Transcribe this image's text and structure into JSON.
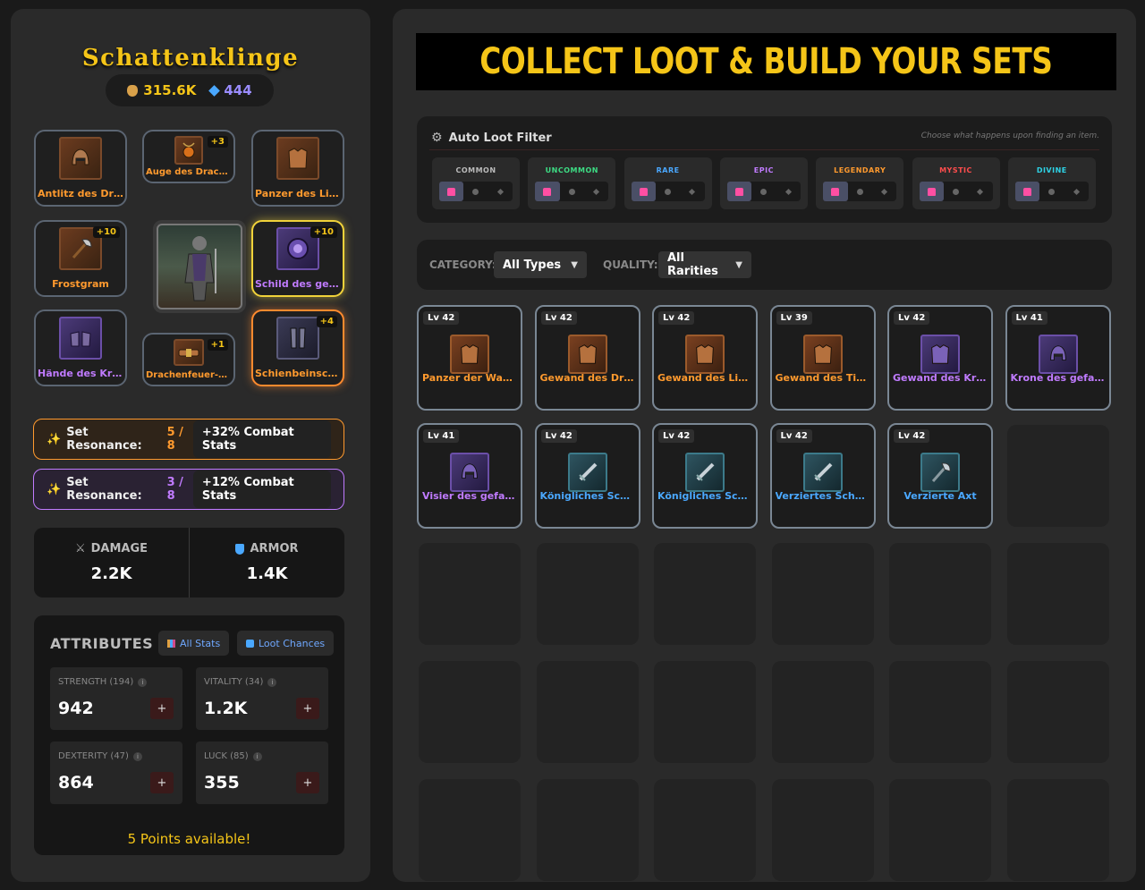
{
  "character": {
    "name": "Schattenklinge",
    "gold": "315.6K",
    "gems": "444"
  },
  "equipment": [
    {
      "id": "helmet",
      "label": "Antlitz des Drac...",
      "rarity": "orange",
      "plus": "",
      "icon": "helmet-icon"
    },
    {
      "id": "amulet",
      "label": "Auge des Drachen",
      "rarity": "orange",
      "plus": "+3",
      "icon": "amulet-icon"
    },
    {
      "id": "chest",
      "label": "Panzer des Lichts",
      "rarity": "orange",
      "plus": "",
      "icon": "chestplate-icon"
    },
    {
      "id": "weapon",
      "label": "Frostgram",
      "rarity": "orange",
      "plus": "+10",
      "icon": "axe-icon"
    },
    {
      "id": "shield",
      "label": "Schild des gefal...",
      "rarity": "purple",
      "plus": "+10",
      "icon": "shield-icon"
    },
    {
      "id": "gloves",
      "label": "Hände des Krie...",
      "rarity": "purple",
      "plus": "",
      "icon": "gauntlet-icon"
    },
    {
      "id": "belt",
      "label": "Drachenfeuer-Gü...",
      "rarity": "orange",
      "plus": "+1",
      "icon": "belt-icon"
    },
    {
      "id": "legs",
      "label": "Schienbeinschu...",
      "rarity": "orange",
      "plus": "+4",
      "icon": "greaves-icon"
    }
  ],
  "resonances": [
    {
      "label": "Set Resonance:",
      "value": "5 / 8",
      "bonus": "+32% Combat Stats",
      "color": "#ff9a2e"
    },
    {
      "label": "Set Resonance:",
      "value": "3 / 8",
      "bonus": "+12% Combat Stats",
      "color": "#c07bff"
    }
  ],
  "combat": {
    "damage_label": "DAMAGE",
    "damage_value": "2.2K",
    "armor_label": "ARMOR",
    "armor_value": "1.4K"
  },
  "attributes": {
    "title": "ATTRIBUTES",
    "all_stats_label": "All Stats",
    "loot_chances_label": "Loot Chances",
    "stats": [
      {
        "label": "STRENGTH (194)",
        "value": "942"
      },
      {
        "label": "VITALITY (34)",
        "value": "1.2K"
      },
      {
        "label": "DEXTERITY (47)",
        "value": "864"
      },
      {
        "label": "LUCK (85)",
        "value": "355"
      }
    ],
    "plus_label": "+",
    "points_text": "5 Points available!"
  },
  "banner": "COLLECT LOOT & BUILD YOUR SETS",
  "loot_filter": {
    "title": "Auto Loot Filter",
    "hint": "Choose what happens upon finding an item.",
    "rarities": [
      {
        "name": "COMMON",
        "color": "#bbbbbb"
      },
      {
        "name": "UNCOMMON",
        "color": "#3ddc84"
      },
      {
        "name": "RARE",
        "color": "#4aa8ff"
      },
      {
        "name": "EPIC",
        "color": "#c07bff"
      },
      {
        "name": "LEGENDARY",
        "color": "#ff9a2e"
      },
      {
        "name": "MYSTIC",
        "color": "#ff4d4d"
      },
      {
        "name": "DIVINE",
        "color": "#2ed3e6"
      }
    ]
  },
  "filters": {
    "category_label": "CATEGORY:",
    "category_value": "All Types",
    "quality_label": "QUALITY:",
    "quality_value": "All Rarities"
  },
  "inventory": [
    {
      "level": "Lv 42",
      "name": "Panzer der Wacht",
      "rarity": "orange",
      "icon": "chestplate-icon"
    },
    {
      "level": "Lv 42",
      "name": "Gewand des Dra...",
      "rarity": "orange",
      "icon": "chestplate-icon"
    },
    {
      "level": "Lv 42",
      "name": "Gewand des Lichts",
      "rarity": "orange",
      "icon": "chestplate-icon"
    },
    {
      "level": "Lv 39",
      "name": "Gewand des Tita...",
      "rarity": "orange",
      "icon": "chestplate-icon"
    },
    {
      "level": "Lv 42",
      "name": "Gewand des Krie...",
      "rarity": "purple",
      "icon": "chestplate-icon"
    },
    {
      "level": "Lv 41",
      "name": "Krone des gefall...",
      "rarity": "purple",
      "icon": "helmet-icon"
    },
    {
      "level": "Lv 41",
      "name": "Visier des gefalle...",
      "rarity": "purple",
      "icon": "helmet-icon"
    },
    {
      "level": "Lv 42",
      "name": "Königliches Sch...",
      "rarity": "blue",
      "icon": "sword-icon"
    },
    {
      "level": "Lv 42",
      "name": "Königliches Sch...",
      "rarity": "blue",
      "icon": "sword-icon"
    },
    {
      "level": "Lv 42",
      "name": "Verziertes Schwert",
      "rarity": "blue",
      "icon": "sword-icon"
    },
    {
      "level": "Lv 42",
      "name": "Verzierte Axt",
      "rarity": "blue",
      "icon": "axe-icon"
    }
  ]
}
